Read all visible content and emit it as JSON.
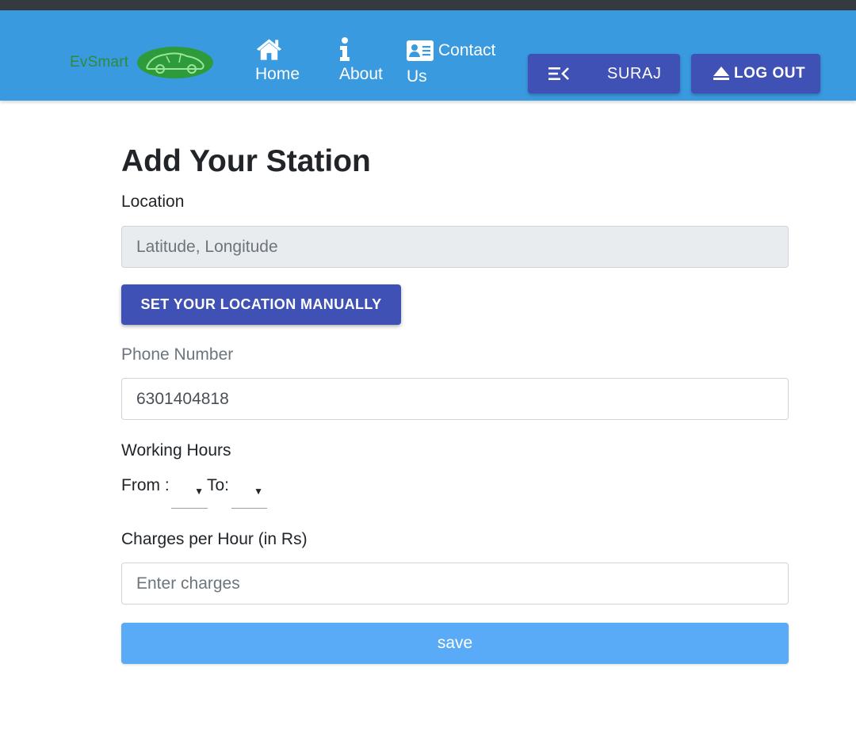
{
  "topbar": {
    "brand": {
      "text": "EvSmart",
      "text_color": "#2e8b3a",
      "logo_icon": "car-logo-icon",
      "logo_color": "#2e9b3a"
    },
    "nav": [
      {
        "label": "Home",
        "icon": "home-icon"
      },
      {
        "label": "About",
        "icon": "info-icon"
      },
      {
        "label_line1": "Contact",
        "label_line2": "Us",
        "icon": "contact-card-icon"
      }
    ],
    "user_button": {
      "icon": "menu-collapse-icon",
      "label": "SURAJ"
    },
    "logout_button": {
      "icon": "eject-icon",
      "label": "LOG OUT"
    },
    "colors": {
      "navbar_bg": "#3a9ae0",
      "button_bg": "#3f51b5",
      "strip": "#343a40"
    }
  },
  "form": {
    "title": "Add Your Station",
    "location": {
      "label": "Location",
      "value": "",
      "placeholder": "Latitude, Longitude"
    },
    "set_location_button": "SET YOUR LOCATION MANUALLY",
    "phone": {
      "label": "Phone Number",
      "value": "6301404818"
    },
    "working_hours": {
      "label": "Working Hours",
      "from_label": "From :",
      "to_label": "To:",
      "from_value": "",
      "to_value": ""
    },
    "charges": {
      "label": "Charges per Hour (in Rs)",
      "value": "",
      "placeholder": "Enter charges"
    },
    "save_button": "save",
    "colors": {
      "save_bg": "#5aabf7",
      "disabled_input_bg": "#e9ecef"
    }
  }
}
